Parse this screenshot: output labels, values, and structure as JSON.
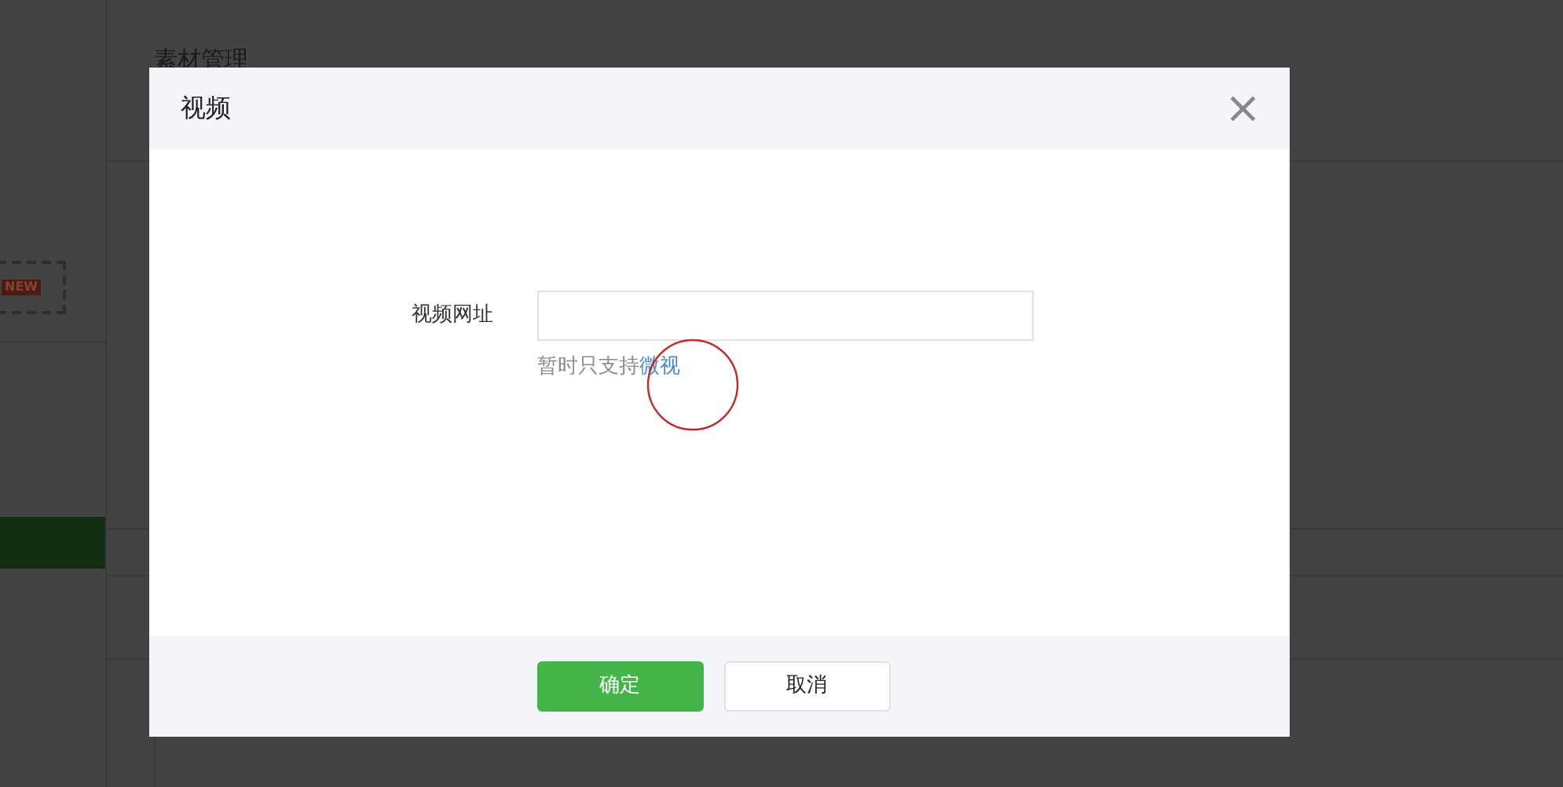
{
  "page": {
    "heading": "素材管理",
    "new_badge": "NEW"
  },
  "dialog": {
    "title": "视频",
    "close": "×",
    "field": {
      "label": "视频网址"
    },
    "hint": {
      "text": "暂时只支持",
      "link": "微视"
    },
    "buttons": [
      {
        "label": "确定",
        "kind": "primary"
      },
      {
        "label": "取消",
        "kind": "secondary"
      }
    ]
  }
}
